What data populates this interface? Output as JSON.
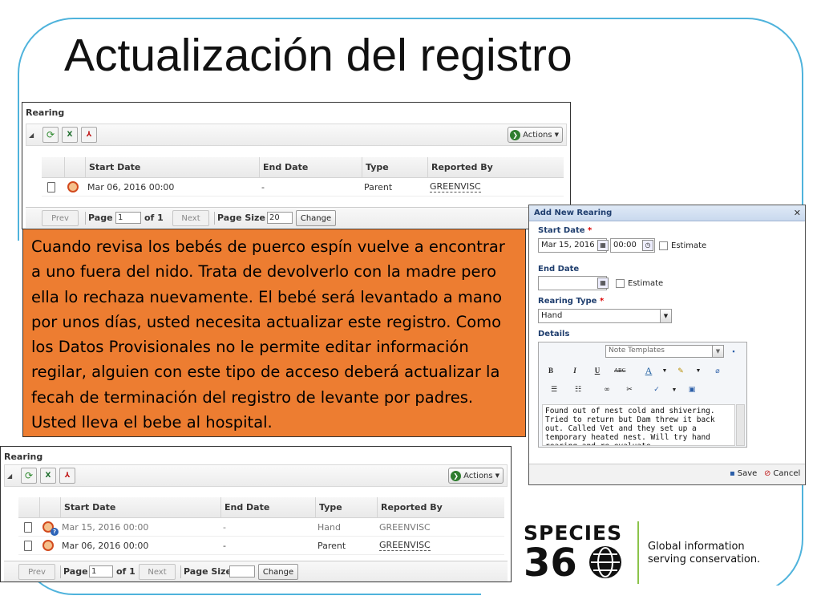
{
  "slide": {
    "title": "Actualización del registro",
    "instructions": "Cuando revisa los bebés de puerco espín vuelve a encontrar a uno fuera del nido. Trata de devolverlo con la madre pero ella lo rechaza nuevamente. El bebé será levantado a mano por unos días, usted necesita actualizar este registro. Como los Datos Provisionales no le permite editar información regilar, alguien con este tipo de acceso deberá actualizar la fecah de terminación del registro de levante por padres. Usted lleva el bebe al hospital."
  },
  "panel_before": {
    "header": "Rearing",
    "actions_label": "Actions",
    "columns": [
      "Start Date",
      "End Date",
      "Type",
      "Reported By"
    ],
    "rows": [
      {
        "start": "Mar 06, 2016 00:00",
        "end": "-",
        "type": "Parent",
        "reported_by": "GREENVISC"
      }
    ],
    "pager": {
      "prev": "Prev",
      "page_label": "Page",
      "page_value": "1",
      "of_label": "of 1",
      "next": "Next",
      "page_size_label": "Page Size",
      "page_size_value": "20",
      "change": "Change"
    }
  },
  "panel_after": {
    "header": "Rearing",
    "actions_label": "Actions",
    "columns": [
      "Start Date",
      "End Date",
      "Type",
      "Reported By"
    ],
    "rows": [
      {
        "start": "Mar 15, 2016 00:00",
        "end": "-",
        "type": "Hand",
        "reported_by": "GREENVISC"
      },
      {
        "start": "Mar 06, 2016 00:00",
        "end": "-",
        "type": "Parent",
        "reported_by": "GREENVISC"
      }
    ],
    "pager": {
      "prev": "Prev",
      "page_label": "Page",
      "page_value": "1",
      "of_label": "of 1",
      "next": "Next",
      "page_size_label": "Page Size",
      "page_size_value": "",
      "change": "Change"
    }
  },
  "dialog": {
    "title": "Add New Rearing",
    "start_date_label": "Start Date",
    "start_date_value": "Mar 15, 2016",
    "start_time_value": "00:00",
    "estimate_label": "Estimate",
    "end_date_label": "End Date",
    "end_date_value": "",
    "rearing_type_label": "Rearing Type",
    "rearing_type_value": "Hand",
    "details_label": "Details",
    "note_templates_placeholder": "Note Templates",
    "details_text": "Found out of nest cold and shivering. Tried to return but Dam threw it back out. Called Vet and they set up a temporary heated nest. Will try hand rearing and re-evaluate.",
    "save_label": "Save",
    "cancel_label": "Cancel",
    "required_mark": "*"
  },
  "logo": {
    "brand_top": "SPECIES",
    "brand_bottom": "360",
    "tagline_line1": "Global information",
    "tagline_line2": "serving conservation."
  },
  "colors": {
    "frame": "#4fb3dc",
    "instruction_box": "#ed7d31",
    "logo_accent": "#8bc34a"
  }
}
